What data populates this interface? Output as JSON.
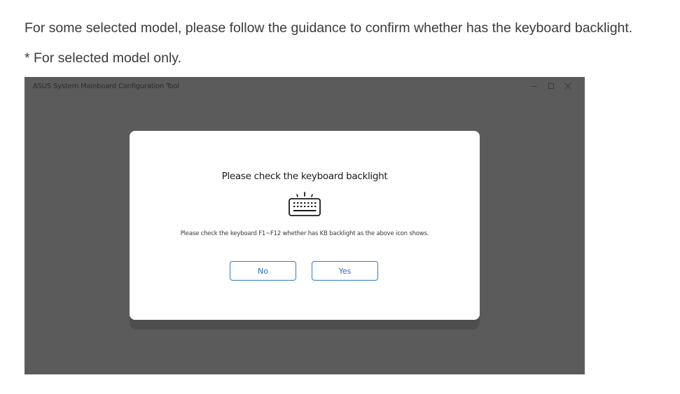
{
  "intro": {
    "text": "For some selected model, please follow the guidance to confirm whether has the keyboard backlight."
  },
  "note": {
    "text": "* For selected model only."
  },
  "window": {
    "title": "ASUS System Mainboard Configuration Tool",
    "controls": {
      "minimize_icon": "minimize-icon",
      "maximize_icon": "maximize-icon",
      "close_icon": "close-icon"
    }
  },
  "dialog": {
    "title": "Please check the keyboard backlight",
    "icon": "keyboard-backlight-icon",
    "message": "Please check the keyboard F1~F12 whether has KB backlight as the above icon shows.",
    "no_label": "No",
    "yes_label": "Yes"
  },
  "colors": {
    "overlay": "#5b5b5b",
    "button_border": "#2d7cc8",
    "button_text": "#2d6db0"
  }
}
